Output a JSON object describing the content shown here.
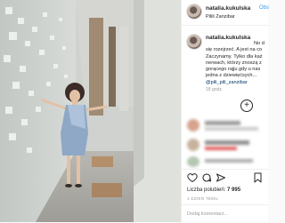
{
  "post": {
    "username": "natalia.kukulska",
    "follow_label": "Obs",
    "location": "Pilili Zanzibar",
    "caption": {
      "lines": [
        "No d",
        "się rozejrzeć. A jest na co",
        "Zaczynamy. Tylko dla każ",
        "nerwach, którzy znoszą z",
        "gorącego rajju gdy u nas",
        "jedna z dziewięćsych..."
      ],
      "mention": "@pili_pili_zanzibar"
    },
    "time": "18 godz.",
    "likes_label": "Liczba polubień:",
    "likes_count": "7 995",
    "posted_ago": "1 DZIEŃ TEMU",
    "comment_placeholder": "Dodaj komentarz..."
  },
  "icons": {
    "like": "heart-icon",
    "comment": "comment-bubble-icon",
    "share": "send-icon",
    "save": "bookmark-icon",
    "more": "plus-circle-icon"
  },
  "colors": {
    "link": "#3897f0",
    "text": "#262626",
    "muted": "#999999",
    "border": "#efefef"
  }
}
